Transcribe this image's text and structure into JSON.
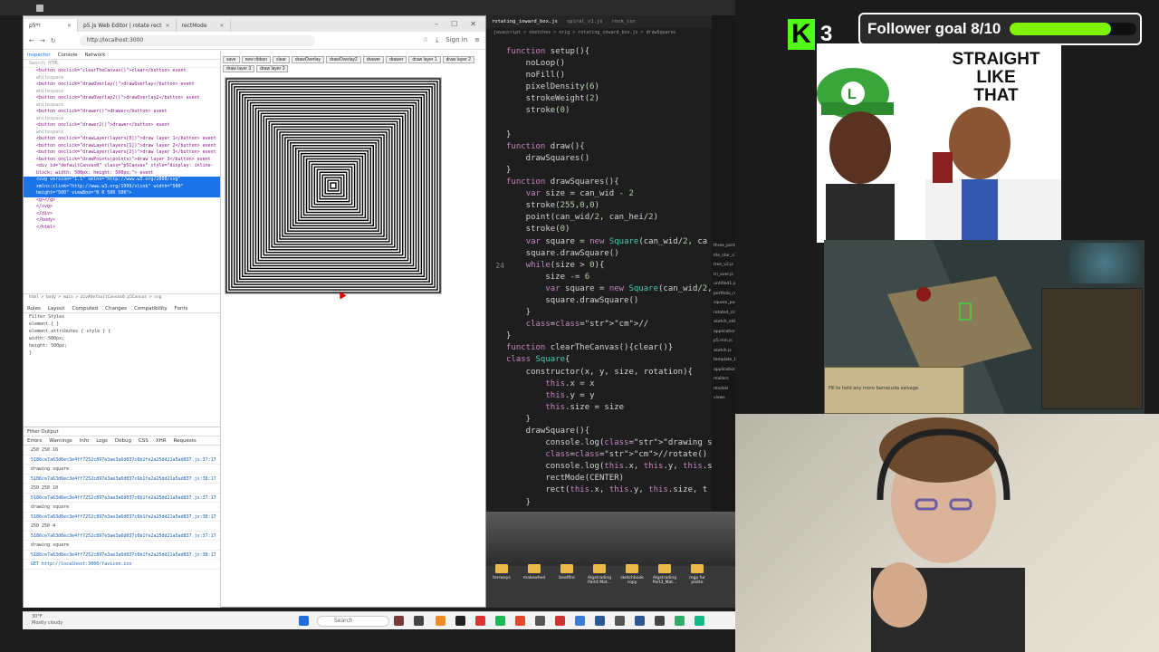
{
  "browser": {
    "tabs": [
      {
        "label": "p5*!",
        "active": true
      },
      {
        "label": "p5.js Web Editor | rotate rect",
        "active": false
      },
      {
        "label": "rectMode",
        "active": false
      }
    ],
    "url": "http://localhost:3000",
    "sign_in": "Sign in"
  },
  "devtools": {
    "tabs": [
      "Inspector",
      "Console",
      "Network"
    ],
    "search_placeholder": "Search HTML",
    "dom_lines": [
      "<button onclick=\"clearTheCanvas()\">clear</button> event",
      "whitespace",
      "<button onclick=\"drawOverlay()\">drawOverlay</button> event",
      "whitespace",
      "<button onclick=\"drawOverlay2()\">drawOverlay2</button> event",
      "whitespace",
      "<button onclick=\"drawer()\">drawer</button> event",
      "whitespace",
      "<button onclick=\"drawer2()\">drawer</button> event",
      "whitespace",
      "<button onclick=\"drawLayer(layers[0])\">draw layer 1</button> event",
      "<button onclick=\"drawLayer(layers[1])\">draw layer 2</button> event",
      "<button onclick=\"drawLayer(layers[2])\">draw layer 3</button> event",
      "<button onclick=\"drawPoints(points)\">draw layer 3</button> event",
      "<div id=\"defaultCanvas0\" class=\"p5Canvas\" style=\"display: inline-",
      "block; width: 500px; height: 500px;\"> event",
      "<svg version=\"1.1\" xmlns=\"http://www.w3.org/2000/svg\"",
      "xmlns:xlink=\"http://www.w3.org/1999/xlink\" width=\"500\"",
      "height=\"500\" viewBox=\"0 0 500 500\">",
      "<g></g>",
      "</svg>",
      "</div>",
      "</body>",
      "</html>"
    ],
    "selected_index": 16,
    "breadcrumb": "html > body > main > div#defaultCanvas0.p5Canvas > svg",
    "panel_tabs": [
      "Rules",
      "Layout",
      "Computed",
      "Changes",
      "Compatibility",
      "Fonts"
    ],
    "filter_styles": "Filter Styles",
    "style_rows": [
      "element { }",
      "element attributes { style } {",
      "width: 500px;",
      "height: 500px;",
      "}"
    ],
    "console_title": "Filter Output",
    "console_filters": [
      "Errors",
      "Warnings",
      "Info",
      "Logs",
      "Debug",
      "CSS",
      "XHR",
      "Requests"
    ],
    "console_lines": [
      {
        "text": "250 250 16",
        "type": "txt"
      },
      {
        "text": "5186ce7a63d6ec3e4ff7252c897e3ae3a6d037c6b1fe2a25dd21a5ad837.js:37:17",
        "type": "link"
      },
      {
        "text": "drawing square",
        "type": "txt"
      },
      {
        "text": "5186ce7a63d6ec3e4ff7252c897e3ae3a6d037c6b1fe2a25dd21a5ad837.js:38:17",
        "type": "link"
      },
      {
        "text": "250 250 10",
        "type": "txt"
      },
      {
        "text": "5186ce7a63d6ec3e4ff7252c897e3ae3a6d037c6b1fe2a25dd21a5ad837.js:37:17",
        "type": "link"
      },
      {
        "text": "drawing square",
        "type": "txt"
      },
      {
        "text": "5186ce7a63d6ec3e4ff7252c897e3ae3a6d037c6b1fe2a25dd21a5ad837.js:38:17",
        "type": "link"
      },
      {
        "text": "250 250 4",
        "type": "txt"
      },
      {
        "text": "5186ce7a63d6ec3e4ff7252c897e3ae3a6d037c6b1fe2a25dd21a5ad837.js:37:17",
        "type": "link"
      },
      {
        "text": "drawing square",
        "type": "txt"
      },
      {
        "text": "5186ce7a63d6ec3e4ff7252c897e3ae3a6d037c6b1fe2a25dd21a5ad837.js:38:17",
        "type": "link"
      },
      {
        "text": "GET http://localhost:3000/favicon.ico",
        "type": "link"
      }
    ]
  },
  "page": {
    "buttons": [
      "save",
      "new ribbon",
      "clear",
      "drawOverlay",
      "drawOverlay2",
      "drawer",
      "drawer",
      "draw layer 1",
      "draw layer 2",
      "draw layer 3",
      "draw layer 3"
    ],
    "square_count": 40
  },
  "editor": {
    "tabs": [
      "rotating_inward_box.js",
      "spiral_v1.js",
      "rock_cor"
    ],
    "crumbs": "javascript > sketches > orig > rotating_inward_box.js > drawSquares",
    "active_line": 24,
    "lines": [
      {
        "ln": "",
        "code": "function setup(){"
      },
      {
        "ln": "",
        "code": "    noLoop()"
      },
      {
        "ln": "",
        "code": "    noFill()"
      },
      {
        "ln": "",
        "code": "    pixelDensity(6)"
      },
      {
        "ln": "",
        "code": "    strokeWeight(2)"
      },
      {
        "ln": "",
        "code": "    stroke(0)"
      },
      {
        "ln": "",
        "code": ""
      },
      {
        "ln": "",
        "code": "}"
      },
      {
        "ln": "",
        "code": "function draw(){"
      },
      {
        "ln": "",
        "code": "    drawSquares()"
      },
      {
        "ln": "",
        "code": "}"
      },
      {
        "ln": "",
        "code": "function drawSquares(){"
      },
      {
        "ln": "",
        "code": "    var size = can_wid - 2"
      },
      {
        "ln": "",
        "code": "    stroke(255,0,0)"
      },
      {
        "ln": "",
        "code": "    point(can_wid/2, can_hei/2)"
      },
      {
        "ln": "",
        "code": "    stroke(0)"
      },
      {
        "ln": "",
        "code": "    var square = new Square(can_wid/2, ca"
      },
      {
        "ln": "",
        "code": "    square.drawSquare()"
      },
      {
        "ln": "24",
        "code": "    while(size > 0){"
      },
      {
        "ln": "",
        "code": "        size -= 6"
      },
      {
        "ln": "",
        "code": "        var square = new Square(can_wid/2,"
      },
      {
        "ln": "",
        "code": "        square.drawSquare()"
      },
      {
        "ln": "",
        "code": "    }"
      },
      {
        "ln": "",
        "code": "    //"
      },
      {
        "ln": "",
        "code": "}"
      },
      {
        "ln": "",
        "code": "function clearTheCanvas(){clear()}"
      },
      {
        "ln": "",
        "code": "class Square{"
      },
      {
        "ln": "",
        "code": "    constructor(x, y, size, rotation){"
      },
      {
        "ln": "",
        "code": "        this.x = x"
      },
      {
        "ln": "",
        "code": "        this.y = y"
      },
      {
        "ln": "",
        "code": "        this.size = size"
      },
      {
        "ln": "",
        "code": "    }"
      },
      {
        "ln": "",
        "code": "    drawSquare(){"
      },
      {
        "ln": "",
        "code": "        console.log(\"drawing square\")"
      },
      {
        "ln": "",
        "code": "        //rotate()"
      },
      {
        "ln": "",
        "code": "        console.log(this.x, this.y, this.s"
      },
      {
        "ln": "",
        "code": "        rectMode(CENTER)"
      },
      {
        "ln": "",
        "code": "        rect(this.x, this.y, this.size, t"
      },
      {
        "ln": "",
        "code": "    }"
      }
    ]
  },
  "explorer_items": [
    "three_portals.js",
    "tile_star_v1.js",
    "tree_v2.js",
    "tri_over.js",
    "untitled1.js",
    "portfolio_noise",
    "square_packing",
    "rotated_circle_sine_osc.js",
    "sketch_old.js",
    "application.js",
    "p5.min.js",
    "sketch.js",
    "template_buffer_sketch.js",
    "application_job.rb",
    "mailers",
    "models",
    "views"
  ],
  "files": [
    {
      "label": "terrways"
    },
    {
      "label": "makewhed"
    },
    {
      "label": "beatfire"
    },
    {
      "label": "Algotrading Part4 Mat..."
    },
    {
      "label": "sketchbook copy"
    },
    {
      "label": "Algotrading Part3_Mat..."
    },
    {
      "label": "mgp fur plotte"
    }
  ],
  "overlay": {
    "kick_logo": "K",
    "kick_count": "3",
    "follower_goal": "Follower goal 8/10",
    "follower_progress": 0.8,
    "meme_text": "STRAIGHT\nLIKE\nTHAT",
    "game_chat": "Fill to hold any more barracuda salvage."
  },
  "taskbar": {
    "weather_temp": "30°F",
    "weather_desc": "Mostly cloudy",
    "search": "Search"
  },
  "colors": {
    "kick_green": "#53fc18",
    "progress_green": "#7ff20a",
    "devtools_select": "#1a73e8"
  }
}
